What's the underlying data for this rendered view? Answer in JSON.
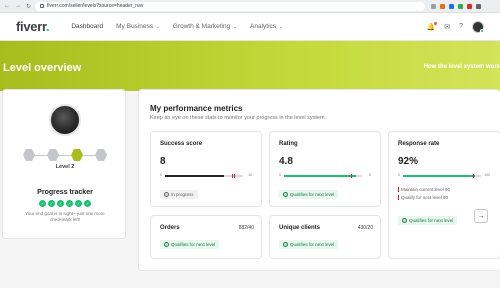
{
  "browser": {
    "url": "fiverr.com/seller/levels?source=header_nav"
  },
  "header": {
    "logo_text": "fiverr",
    "logo_dot": ".",
    "nav": [
      {
        "label": "Dashboard"
      },
      {
        "label": "My Business"
      },
      {
        "label": "Growth & Marketing"
      },
      {
        "label": "Analytics"
      }
    ]
  },
  "band": {
    "title": "Level overview",
    "link": "How the level system work"
  },
  "profile": {
    "level_label": "Level 2",
    "levels_total": 4,
    "current_level_index": 2,
    "tracker_title": "Progress tracker",
    "checks_total": 6,
    "checks_done": 6,
    "tracker_desc": "Your end goal is in sight—just one more checkmark left!"
  },
  "perf": {
    "title": "My performance metrics",
    "subtitle": "Keep an eye on these stats to monitor your progress in the level system."
  },
  "metrics": {
    "success": {
      "name": "Success score",
      "value": "8",
      "min": "0",
      "max": "10",
      "fill_fraction": 0.75,
      "badge": "In progress"
    },
    "rating": {
      "name": "Rating",
      "value": "4.8",
      "min": "0",
      "max": "5",
      "fill_fraction": 0.92,
      "badge": "Qualifies for next level"
    },
    "response": {
      "name": "Response rate",
      "value": "92%",
      "min": "0",
      "max": "100",
      "fill_fraction": 0.92,
      "legend_maintain": "Maintain current level 90",
      "legend_qualify": "Qualify for next level 90"
    },
    "orders": {
      "name": "Orders",
      "fraction": "882/40",
      "badge": "Qualifies for next level"
    },
    "clients": {
      "name": "Unique clients",
      "fraction": "430/20",
      "badge": "Qualifies for next level"
    },
    "response_badge": "Qualifies for next level"
  },
  "colors": {
    "brand_green": "#1dbf73",
    "band_green": "#a7bd1d",
    "bar_dark": "#222325",
    "bar_green": "#1dbf73",
    "mark_red": "#c62828"
  }
}
